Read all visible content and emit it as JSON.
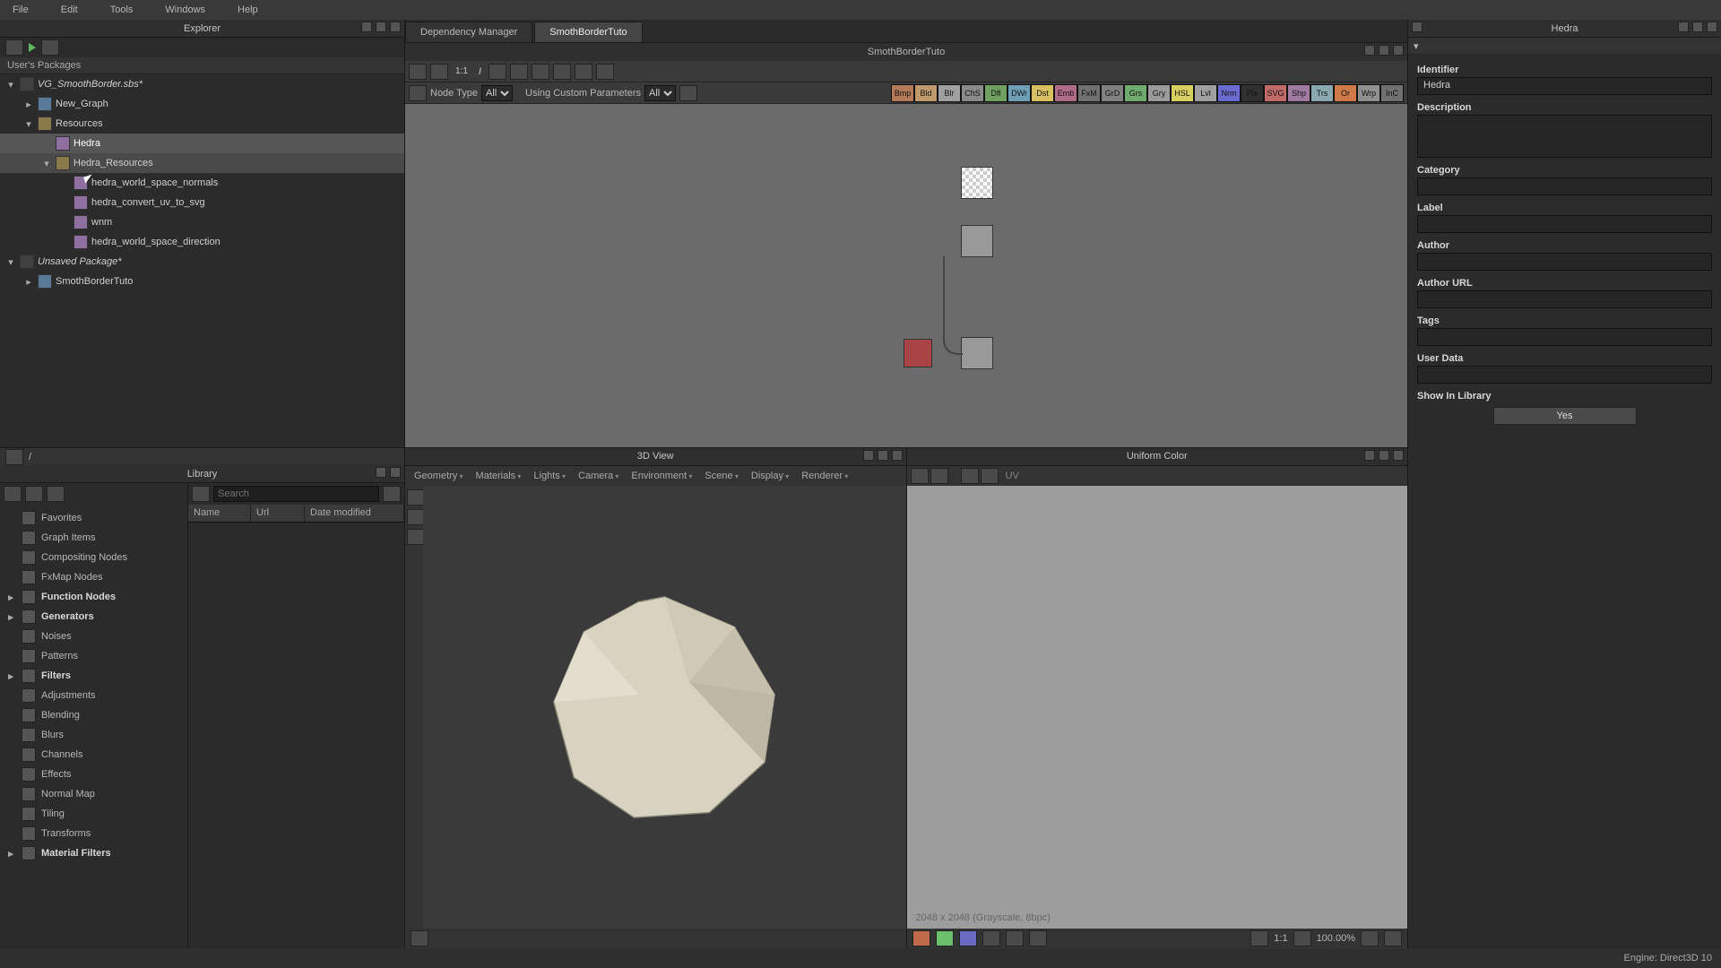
{
  "menubar": [
    "File",
    "Edit",
    "Tools",
    "Windows",
    "Help"
  ],
  "explorer": {
    "title": "Explorer",
    "section": "User's Packages",
    "tree": [
      {
        "depth": 0,
        "exp": "▾",
        "icon": "pkg",
        "label": "VG_SmoothBorder.sbs*",
        "italic": true
      },
      {
        "depth": 1,
        "exp": "▸",
        "icon": "graph",
        "label": "New_Graph"
      },
      {
        "depth": 1,
        "exp": "▾",
        "icon": "folder",
        "label": "Resources"
      },
      {
        "depth": 2,
        "exp": "",
        "icon": "res",
        "label": "Hedra",
        "sel": true
      },
      {
        "depth": 2,
        "exp": "▾",
        "icon": "folder",
        "label": "Hedra_Resources",
        "hov": true
      },
      {
        "depth": 3,
        "exp": "",
        "icon": "res",
        "label": "hedra_world_space_normals"
      },
      {
        "depth": 3,
        "exp": "",
        "icon": "res",
        "label": "hedra_convert_uv_to_svg"
      },
      {
        "depth": 3,
        "exp": "",
        "icon": "res",
        "label": "wnm"
      },
      {
        "depth": 3,
        "exp": "",
        "icon": "res",
        "label": "hedra_world_space_direction"
      },
      {
        "depth": 0,
        "exp": "▾",
        "icon": "pkg",
        "label": "Unsaved Package*",
        "italic": true
      },
      {
        "depth": 1,
        "exp": "▸",
        "icon": "graph",
        "label": "SmothBorderTuto"
      }
    ],
    "path": "/"
  },
  "library": {
    "title": "Library",
    "search_placeholder": "Search",
    "columns": [
      "Name",
      "Url",
      "Date modified"
    ],
    "filters": [
      {
        "type": "item",
        "label": "Favorites"
      },
      {
        "type": "item",
        "label": "Graph Items"
      },
      {
        "type": "item",
        "label": "Compositing Nodes"
      },
      {
        "type": "item",
        "label": "FxMap Nodes"
      },
      {
        "type": "cat",
        "label": "Function Nodes"
      },
      {
        "type": "cat",
        "label": "Generators"
      },
      {
        "type": "item",
        "label": "Noises"
      },
      {
        "type": "item",
        "label": "Patterns"
      },
      {
        "type": "cat",
        "label": "Filters"
      },
      {
        "type": "item",
        "label": "Adjustments"
      },
      {
        "type": "item",
        "label": "Blending"
      },
      {
        "type": "item",
        "label": "Blurs"
      },
      {
        "type": "item",
        "label": "Channels"
      },
      {
        "type": "item",
        "label": "Effects"
      },
      {
        "type": "item",
        "label": "Normal Map"
      },
      {
        "type": "item",
        "label": "Tiling"
      },
      {
        "type": "item",
        "label": "Transforms"
      },
      {
        "type": "cat",
        "label": "Material Filters"
      }
    ]
  },
  "graph": {
    "tabs": [
      {
        "label": "Dependency Manager",
        "active": false
      },
      {
        "label": "SmothBorderTuto",
        "active": true
      }
    ],
    "title": "SmothBorderTuto",
    "node_type_label": "Node Type",
    "node_type_value": "All",
    "custom_params_label": "Using Custom Parameters",
    "custom_params_value": "All",
    "palette": [
      {
        "l": "Bmp",
        "c": "#b47a5a"
      },
      {
        "l": "Bld",
        "c": "#c09a6a"
      },
      {
        "l": "Blr",
        "c": "#a0a0a0"
      },
      {
        "l": "ChS",
        "c": "#8a8a8a"
      },
      {
        "l": "Dfl",
        "c": "#6fa060"
      },
      {
        "l": "DWr",
        "c": "#6f9fb5"
      },
      {
        "l": "Dst",
        "c": "#d8c060"
      },
      {
        "l": "Emb",
        "c": "#b06a8a"
      },
      {
        "l": "FxM",
        "c": "#707070"
      },
      {
        "l": "GrD",
        "c": "#808080"
      },
      {
        "l": "Grs",
        "c": "#6faa6f"
      },
      {
        "l": "Gry",
        "c": "#9a9a9a"
      },
      {
        "l": "HSL",
        "c": "#d8d060"
      },
      {
        "l": "Lvl",
        "c": "#a0a0a0"
      },
      {
        "l": "Nrm",
        "c": "#6a6ad0"
      },
      {
        "l": "Plx",
        "c": "#303030"
      },
      {
        "l": "SVG",
        "c": "#c06a6a"
      },
      {
        "l": "Shp",
        "c": "#a07aa0"
      },
      {
        "l": "Trs",
        "c": "#8aa8b0"
      },
      {
        "l": "Or",
        "c": "#d07a4a"
      },
      {
        "l": "Wrp",
        "c": "#909090"
      },
      {
        "l": "InC",
        "c": "#707070"
      }
    ]
  },
  "view3d": {
    "title": "3D View",
    "menus": [
      "Geometry",
      "Materials",
      "Lights",
      "Camera",
      "Environment",
      "Scene",
      "Display",
      "Renderer"
    ]
  },
  "view2d": {
    "title": "Uniform Color",
    "info": "2048 x 2048 (Grayscale, 8bpc)",
    "zoom": "100.00%"
  },
  "props": {
    "title": "Hedra",
    "fields": {
      "identifier_label": "Identifier",
      "identifier_value": "Hedra",
      "description_label": "Description",
      "category_label": "Category",
      "label_label": "Label",
      "author_label": "Author",
      "author_url_label": "Author URL",
      "tags_label": "Tags",
      "user_data_label": "User Data",
      "show_label": "Show In Library",
      "show_value": "Yes"
    }
  },
  "statusbar": {
    "engine": "Engine: Direct3D 10"
  }
}
